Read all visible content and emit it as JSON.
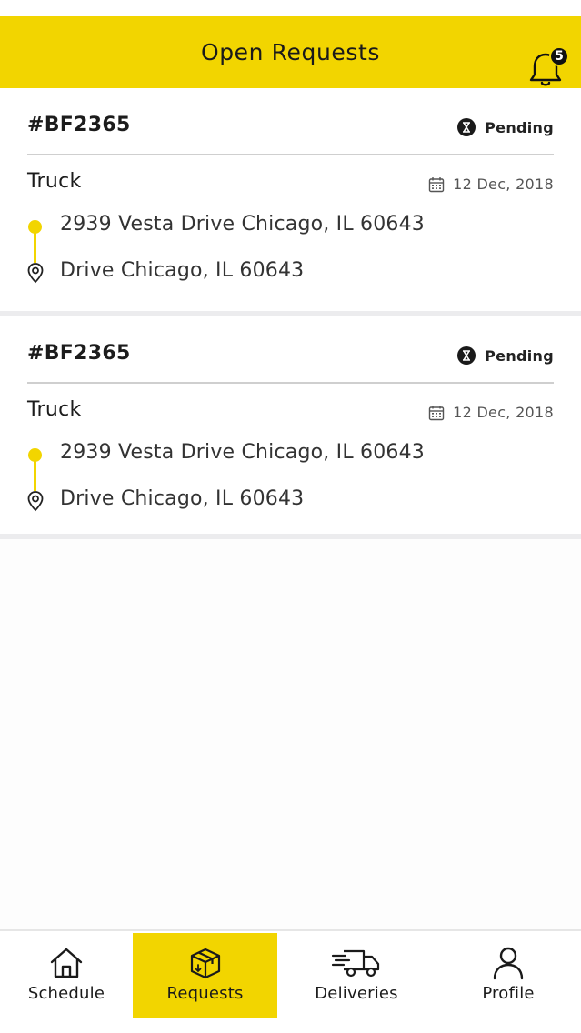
{
  "header": {
    "title": "Open Requests",
    "notifications_count": "5",
    "bell_icon": "bell-icon",
    "accent_color": "#f2d500"
  },
  "requests": [
    {
      "id": "#BF2365",
      "status": "Pending",
      "vehicle": "Truck",
      "date": "12 Dec, 2018",
      "pickup": "2939 Vesta Drive Chicago, IL 60643",
      "dropoff": "Drive Chicago, IL 60643"
    },
    {
      "id": "#BF2365",
      "status": "Pending",
      "vehicle": "Truck",
      "date": "12 Dec, 2018",
      "pickup": "2939 Vesta Drive Chicago, IL 60643",
      "dropoff": "Drive Chicago, IL 60643"
    }
  ],
  "nav": {
    "items": [
      {
        "label": "Schedule",
        "icon": "home-icon"
      },
      {
        "label": "Requests",
        "icon": "box-icon",
        "active": true
      },
      {
        "label": "Deliveries",
        "icon": "truck-icon"
      },
      {
        "label": "Profile",
        "icon": "user-icon"
      }
    ]
  }
}
